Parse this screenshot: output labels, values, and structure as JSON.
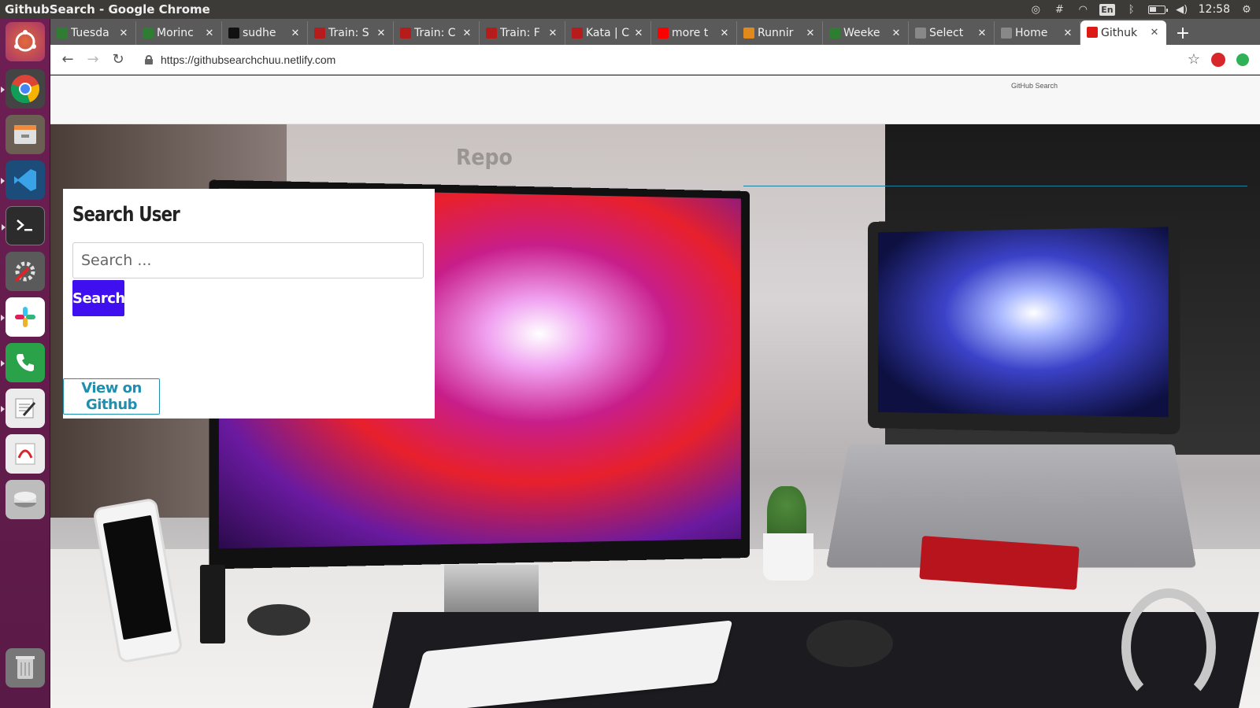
{
  "window": {
    "title": "GithubSearch - Google Chrome"
  },
  "system_tray": {
    "language": "En",
    "clock": "12:58"
  },
  "launcher": {
    "items": [
      "ubuntu",
      "chrome",
      "files",
      "vscode",
      "terminal",
      "settings",
      "slack",
      "phone",
      "text-editor",
      "pdf-viewer",
      "disk",
      "trash"
    ]
  },
  "tabs": [
    {
      "label": "Tuesda",
      "favicon": "#2e7d32"
    },
    {
      "label": "Morinc",
      "favicon": "#2e7d32"
    },
    {
      "label": "sudhe",
      "favicon": "#111111"
    },
    {
      "label": "Train: S",
      "favicon": "#b71c1c"
    },
    {
      "label": "Train: C",
      "favicon": "#b71c1c"
    },
    {
      "label": "Train: F",
      "favicon": "#b71c1c"
    },
    {
      "label": "Kata | C",
      "favicon": "#b71c1c"
    },
    {
      "label": "more t",
      "favicon": "#ff0000"
    },
    {
      "label": "Runnir",
      "favicon": "#e08a1e"
    },
    {
      "label": "Weeke",
      "favicon": "#2e7d32"
    },
    {
      "label": "Select",
      "favicon": "#888888"
    },
    {
      "label": "Home",
      "favicon": "#888888"
    },
    {
      "label": "Githuk",
      "favicon": "#dd1b16",
      "active": true
    }
  ],
  "address_bar": {
    "url": "https://githubsearchchuu.netlify.com"
  },
  "page": {
    "brand": "GitHub Search",
    "repos_heading": "Repo",
    "search_card": {
      "title": "Search User",
      "input_placeholder": "Search ...",
      "search_button": "Search",
      "github_button": "View on Github"
    }
  },
  "colors": {
    "search_button_bg": "#3f0ff0",
    "github_button_accent": "#1f8fb0",
    "launcher_bg": "#6d1f53"
  }
}
